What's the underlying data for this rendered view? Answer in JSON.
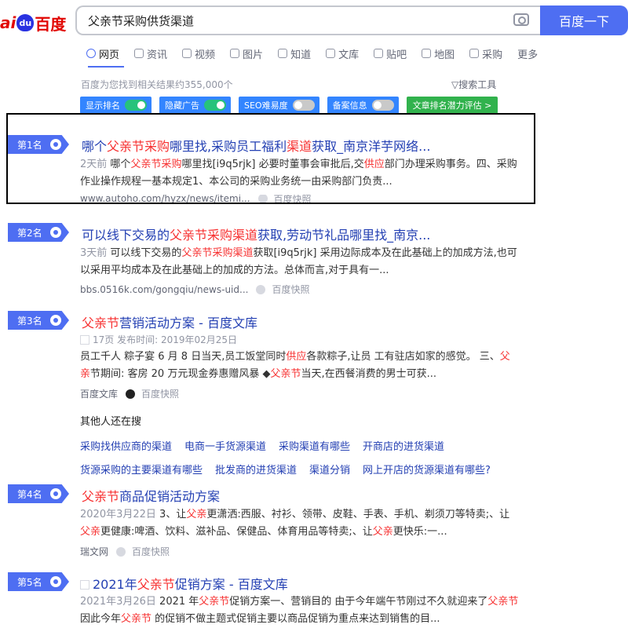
{
  "logo": {
    "part1": "ai",
    "paw": "du",
    "part2": "百度"
  },
  "search": {
    "query": "父亲节采购供货渠道",
    "button": "百度一下"
  },
  "tabs": [
    {
      "label": "网页",
      "icon": "search-icon"
    },
    {
      "label": "资讯",
      "icon": "news-icon"
    },
    {
      "label": "视频",
      "icon": "video-icon"
    },
    {
      "label": "图片",
      "icon": "image-icon"
    },
    {
      "label": "知道",
      "icon": "question-icon"
    },
    {
      "label": "文库",
      "icon": "document-icon"
    },
    {
      "label": "贴吧",
      "icon": "tieba-icon"
    },
    {
      "label": "地图",
      "icon": "map-pin-icon"
    },
    {
      "label": "采购",
      "icon": "shop-icon"
    },
    {
      "label": "更多",
      "icon": ""
    }
  ],
  "result_count": "百度为您找到相关结果约355,000个",
  "tools": "▽搜索工具",
  "plugins": [
    {
      "label": "显示排名",
      "state": "on"
    },
    {
      "label": "隐藏广告",
      "state": "on"
    },
    {
      "label": "SEO难易度",
      "state": "off"
    },
    {
      "label": "备案信息",
      "state": "off"
    },
    {
      "label": "文章排名潜力评估 >",
      "state": "link"
    }
  ],
  "results": [
    {
      "rank": "第1名",
      "title_parts": [
        "哪个",
        "父亲节采购",
        "哪里找,采购员工福利",
        "渠道",
        "获取_南京洋芋网络..."
      ],
      "abs_date": "2天前",
      "abs_parts": [
        "哪个",
        "父亲节采购",
        "哪里找[i9q5rjk] 必要时董事会审批后,交",
        "供应",
        "部门办理采购事务。四、采购作业操作规程一基本规定1、本公司的采购业务统一由采购部门负责..."
      ],
      "source": "www.autoho.com/hyzx/news/itemi...",
      "snapshot": "百度快照"
    },
    {
      "rank": "第2名",
      "title_parts": [
        "可以线下交易的",
        "父亲节采购渠道",
        "获取,劳动节礼品哪里找_南京..."
      ],
      "abs_date": "3天前",
      "abs_parts": [
        "可以线下交易的",
        "父亲节采购渠道",
        "获取[i9q5rjk] 采用边际成本及在此基础上的加成方法,也可以采用平均成本及在此基础上的加成的方法。总体而言,对于具有一..."
      ],
      "source": "bbs.0516k.com/gongqiu/news-uid...",
      "snapshot": "百度快照"
    },
    {
      "rank": "第3名",
      "title_parts": [
        "",
        "父亲节",
        "营销活动方案 - 百度文库"
      ],
      "meta": "17页 发布时间: 2019年02月25日",
      "abs_parts": [
        "员工千人 粽子宴 6 月 8 日当天,员工饭堂同时",
        "供应",
        "各款粽子,让员 工有驻店如家的感觉。 三、",
        "父亲",
        "节期间: 客房 20 万元现金券惠赠风暴 ◆",
        "父亲节",
        "当天,在西餐消费的男士可获..."
      ],
      "source": "百度文库",
      "snapshot": "百度快照"
    },
    {
      "rank": "第4名",
      "title_parts": [
        "",
        "父亲节",
        "商品促销活动方案"
      ],
      "abs_date": "2020年3月22日",
      "abs_parts": [
        "3、让",
        "父亲",
        "更潇洒:西服、衬衫、领带、皮鞋、手表、手机、剃须刀等特卖;、让",
        "父亲",
        "更健康:啤酒、饮料、滋补品、保健品、体育用品等特卖;、让",
        "父亲",
        "更快乐:一..."
      ],
      "source": "瑞文网",
      "snapshot": "百度快照"
    },
    {
      "rank": "第5名",
      "title_parts": [
        "2021年",
        "父亲节",
        "促销方案 - 百度文库"
      ],
      "abs_date": "2021年3月26日",
      "abs_parts": [
        "2021 年",
        "父亲节",
        "促销方案一、营销目的 由于今年端午节刚过不久就迎来了",
        "父亲节",
        "因此今年",
        "父亲节",
        " 的促销不做主题式促销主要以商品促销为重点来达到销售的目..."
      ]
    }
  ],
  "related": {
    "title": "其他人还在搜",
    "row1": [
      "采购找供应商的渠道",
      "电商一手货源渠道",
      "采购渠道有哪些",
      "开商店的进货渠道"
    ],
    "row2": [
      "货源采购的主要渠道有哪些",
      "批发商的进货渠道",
      "渠道分销",
      "网上开店的货源渠道有哪些?"
    ]
  }
}
